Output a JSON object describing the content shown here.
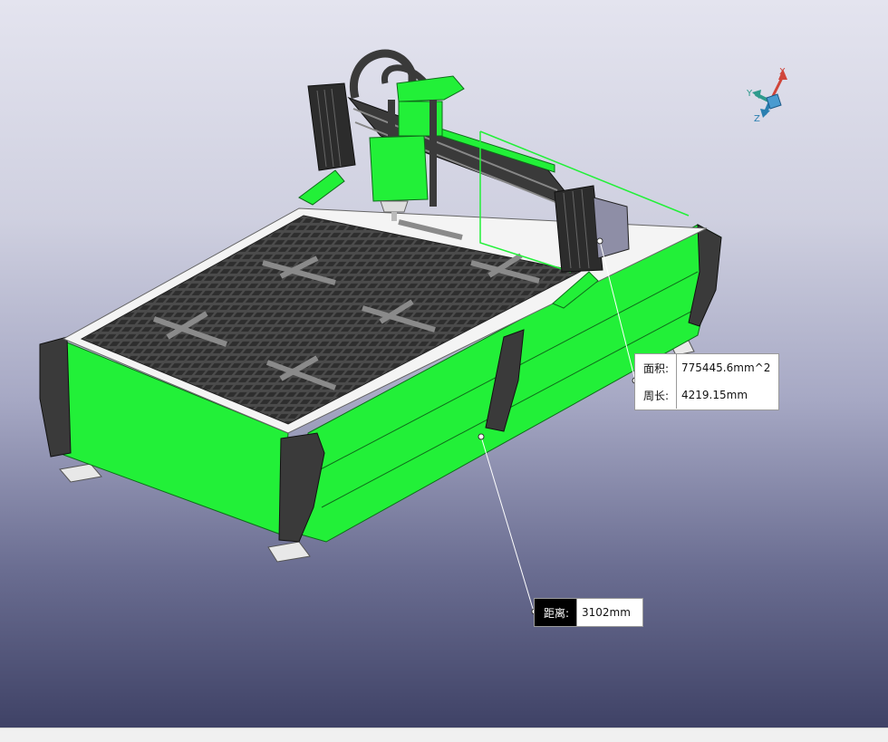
{
  "measurements": {
    "area": {
      "label": "面积:",
      "value": "775445.6mm^2"
    },
    "perimeter": {
      "label": "周长:",
      "value": "4219.15mm"
    },
    "distance": {
      "label": "距离:",
      "value": "3102mm"
    }
  },
  "triad": {
    "x": "X",
    "y": "Y",
    "z": "Z"
  },
  "colors": {
    "selection_green": "#22f038",
    "dark_part": "#3a3a3a",
    "table": "#3c3c3c",
    "x_axis": "#d0453a",
    "y_axis": "#2e9a8c",
    "z_axis": "#2a7fb0"
  }
}
